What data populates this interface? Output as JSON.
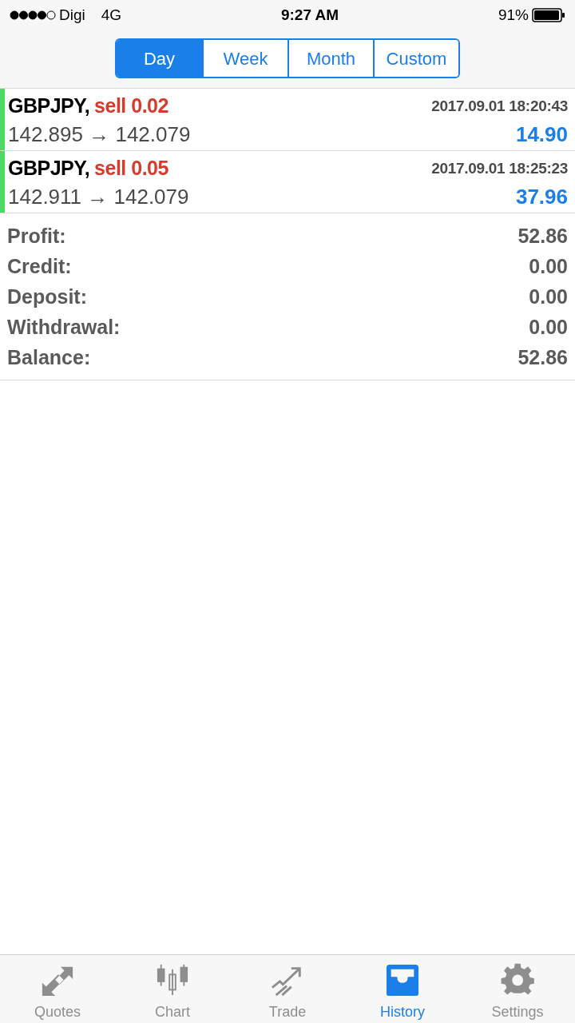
{
  "status_bar": {
    "carrier": "Digi",
    "network": "4G",
    "time": "9:27 AM",
    "battery": "91%"
  },
  "periods": [
    {
      "label": "Day",
      "selected": true
    },
    {
      "label": "Week",
      "selected": false
    },
    {
      "label": "Month",
      "selected": false
    },
    {
      "label": "Custom",
      "selected": false
    }
  ],
  "deals": [
    {
      "symbol": "GBPJPY,",
      "side": "sell 0.02",
      "time": "2017.09.01 18:20:43",
      "prices": "142.895 → 142.079",
      "profit": "14.90"
    },
    {
      "symbol": "GBPJPY,",
      "side": "sell 0.05",
      "time": "2017.09.01 18:25:23",
      "prices": "142.911 → 142.079",
      "profit": "37.96"
    }
  ],
  "summary": [
    {
      "label": "Profit:",
      "value": "52.86"
    },
    {
      "label": "Credit:",
      "value": "0.00"
    },
    {
      "label": "Deposit:",
      "value": "0.00"
    },
    {
      "label": "Withdrawal:",
      "value": "0.00"
    },
    {
      "label": "Balance:",
      "value": "52.86"
    }
  ],
  "tab_bar": [
    {
      "kind": "quotes",
      "label": "Quotes",
      "selected": false
    },
    {
      "kind": "chart",
      "label": "Chart",
      "selected": false
    },
    {
      "kind": "trade",
      "label": "Trade",
      "selected": false
    },
    {
      "kind": "history",
      "label": "History",
      "selected": true
    },
    {
      "kind": "settings",
      "label": "Settings",
      "selected": false
    }
  ]
}
